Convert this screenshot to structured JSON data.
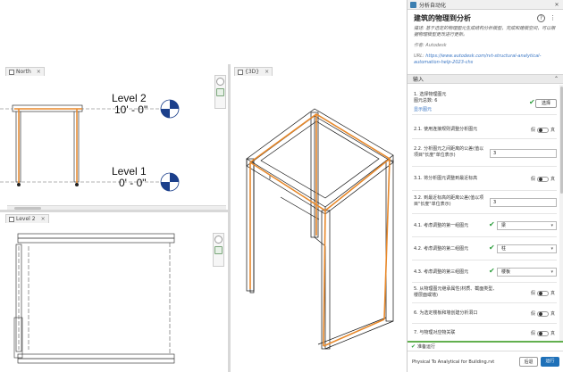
{
  "app": {
    "title": "分析自动化"
  },
  "graph": {
    "title": "建筑的物理到分析",
    "description": "描述: 基于选定的物理图元生成结构分析模型，完成和建模空间，可以根据物理模型更改进行更新。",
    "author": "作者: Autodesk",
    "url_label": "URL:",
    "url": "https://www.autodesk.com/rvt-structural-analytical-automation-help-2023-chs"
  },
  "inputs_header": {
    "label": "输入"
  },
  "inputs": {
    "r1": {
      "label": "1. 选择物理图元",
      "count": "图元总数: 6",
      "show_link": "显示图元",
      "button": "选择"
    },
    "r2": {
      "label": "2.1. 使用连接规则调整分析图元",
      "off": "假",
      "on": "真"
    },
    "r3": {
      "label": "2.2. 分析图元之间距离的公差(值以项目\"长度\"单位表示)",
      "value": "3"
    },
    "r4": {
      "label": "3.1. 将分析图元调整到最近标高",
      "off": "假",
      "on": "真"
    },
    "r5": {
      "label": "3.2. 到最近标高的距离公差(值以项目\"长度\"单位表示)",
      "value": "3"
    },
    "r6": {
      "label": "4.1. 考虑调整的第一组图元",
      "value": "梁"
    },
    "r7": {
      "label": "4.2. 考虑调整的第二组图元",
      "value": "柱"
    },
    "r8": {
      "label": "4.3. 考虑调整的第三组图元",
      "value": "楼板"
    },
    "r9": {
      "label": "5. 从物理图元继承属性(材质、截面类型、楼层面或墙)",
      "off": "假",
      "on": "真"
    },
    "r10": {
      "label": "6. 为选定楼板和墙创建分析洞口",
      "off": "假",
      "on": "真"
    },
    "r11": {
      "label": "7. 与物理对应物关联",
      "off": "假",
      "on": "真"
    }
  },
  "status": {
    "text": "准备运行"
  },
  "footer": {
    "file": "Physical To Analytical for Building.rvt",
    "back": "后退",
    "run": "运行"
  },
  "views": {
    "north_tab": "North",
    "level2_tab": "Level 2",
    "view3d_tab": "{3D}",
    "level2_name": "Level 2",
    "level2_elev": "10' - 0\"",
    "level1_name": "Level 1",
    "level1_elev": "0' - 0\""
  },
  "colors": {
    "accent": "#1e70b8",
    "analytical": "#e8892b",
    "ok": "#2e9e3e"
  }
}
